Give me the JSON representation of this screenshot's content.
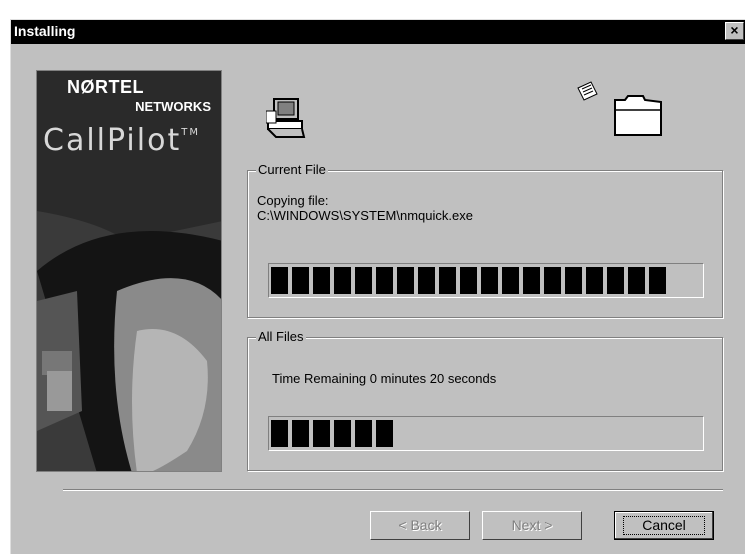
{
  "window": {
    "title": "Installing",
    "close_symbol": "×"
  },
  "banner": {
    "logo_line1": "NØRTEL",
    "logo_line2": "NETWORKS",
    "product": "CallPilot",
    "trademark": "TM"
  },
  "icons": {
    "computer": "computer-icon",
    "file": "file-icon",
    "folder": "folder-icon"
  },
  "current_file": {
    "label": "Current File",
    "line1": "Copying file:",
    "line2": "C:\\WINDOWS\\SYSTEM\\nmquick.exe",
    "progress_percent": 92
  },
  "all_files": {
    "label": "All Files",
    "time_remaining": "Time Remaining 0 minutes 20 seconds",
    "progress_percent": 29
  },
  "buttons": {
    "back": "< Back",
    "next": "Next >",
    "cancel": "Cancel"
  },
  "colors": {
    "face": "#c0c0c0",
    "titlebar": "#000000",
    "progress": "#000000"
  }
}
